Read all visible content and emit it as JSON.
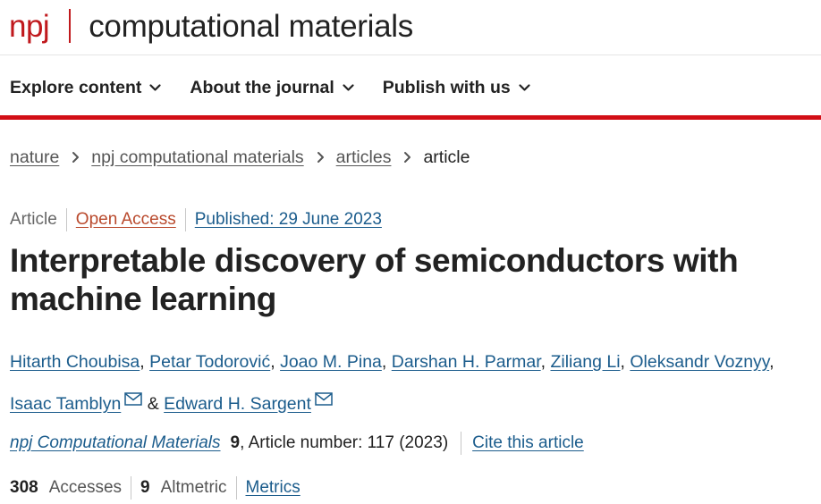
{
  "header": {
    "brand_npj": "npj",
    "brand_name": "computational materials"
  },
  "nav": {
    "items": [
      {
        "label": "Explore content"
      },
      {
        "label": "About the journal"
      },
      {
        "label": "Publish with us"
      }
    ]
  },
  "breadcrumb": {
    "items": [
      "nature",
      "npj computational materials",
      "articles"
    ],
    "current": "article"
  },
  "meta": {
    "type": "Article",
    "access": "Open Access",
    "published": "Published: 29 June 2023"
  },
  "title": {
    "line1": "Interpretable discovery of semiconductors with",
    "line2": "machine learning"
  },
  "authors": {
    "list": [
      "Hitarth Choubisa",
      "Petar Todorović",
      "Joao M. Pina",
      "Darshan H. Parmar",
      "Ziliang Li",
      "Oleksandr Voznyy",
      "Isaac Tamblyn",
      "Edward H. Sargent"
    ],
    "separator": ",",
    "and": "&"
  },
  "journal": {
    "name": "npj Computational Materials",
    "volume": "9",
    "details": ", Article number: 117 (2023)",
    "cite": "Cite this article"
  },
  "metrics": {
    "accesses_count": "308",
    "accesses_label": "Accesses",
    "altmetric_count": "9",
    "altmetric_label": "Altmetric",
    "metrics_link": "Metrics"
  },
  "colors": {
    "brand_red": "#c0191d",
    "nav_bar_red": "#d20f16",
    "link_blue": "#1b5c8c",
    "open_access_orange": "#b9492c"
  },
  "icons": {
    "nav_chevron": "chevron-down-icon",
    "breadcrumb_separator": "chevron-right-icon",
    "author_email": "email-icon"
  }
}
